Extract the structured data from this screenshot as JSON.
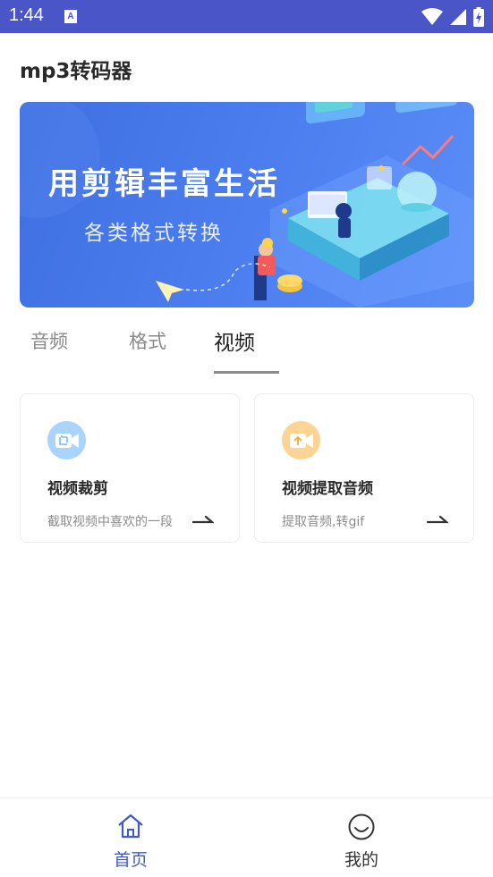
{
  "status_bar": {
    "time": "1:44",
    "notification_letter": "A",
    "icons": [
      "wifi-icon",
      "signal-icon",
      "battery-icon"
    ]
  },
  "app": {
    "title": "mp3转码器"
  },
  "banner": {
    "headline": "用剪辑丰富生活",
    "subline": "各类格式转换"
  },
  "tabs": [
    {
      "label": "音频",
      "active": false
    },
    {
      "label": "格式",
      "active": false
    },
    {
      "label": "视频",
      "active": true
    }
  ],
  "cards": [
    {
      "title": "视频裁剪",
      "desc": "截取视频中喜欢的一段",
      "icon": "video-crop-icon",
      "icon_color": "#8ec4f8"
    },
    {
      "title": "视频提取音频",
      "desc": "提取音频,转gif",
      "icon": "video-extract-icon",
      "icon_color": "#f8c16e"
    }
  ],
  "bottom_nav": [
    {
      "label": "首页",
      "icon": "home-icon",
      "active": true
    },
    {
      "label": "我的",
      "icon": "smile-icon",
      "active": false
    }
  ],
  "colors": {
    "accent": "#4a55c8",
    "nav_active": "#3f5ac8",
    "nav_inactive": "#333333"
  }
}
